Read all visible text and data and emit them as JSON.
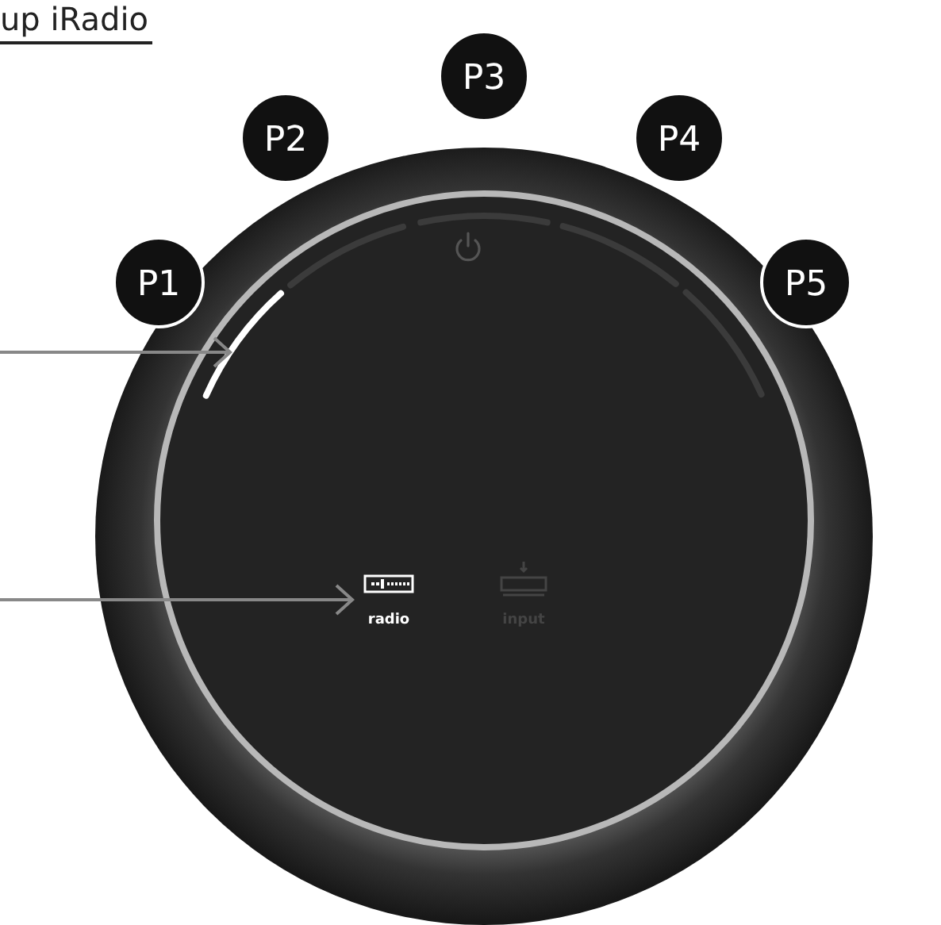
{
  "heading": {
    "text": "up iRadio"
  },
  "presets": [
    {
      "label": "P1",
      "selected": true
    },
    {
      "label": "P2",
      "selected": false
    },
    {
      "label": "P3",
      "selected": false
    },
    {
      "label": "P4",
      "selected": false
    },
    {
      "label": "P5",
      "selected": false
    }
  ],
  "sources": [
    {
      "kind": "radio",
      "label": "radio",
      "selected": true
    },
    {
      "kind": "input",
      "label": "input",
      "selected": false
    }
  ]
}
